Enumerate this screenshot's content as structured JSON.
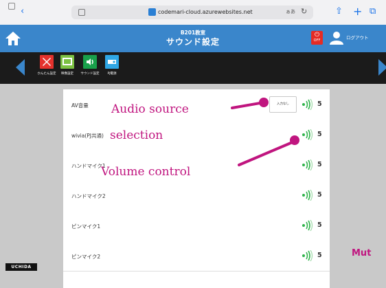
{
  "browser": {
    "url": "codemari-cloud.azurewebsites.net",
    "back_label": "‹",
    "aa_label": "ぁあ",
    "reload_label": "↻",
    "share_label": "⇧",
    "newtab_label": "+",
    "tabs_label": "⧉"
  },
  "header": {
    "room": "B201教室",
    "title": "サウンド設定",
    "off_label": "OFF",
    "logout_label": "ログアウト"
  },
  "toolbar": {
    "items": [
      {
        "label": "かんたん設定",
        "icon": "quick-setup-icon",
        "color": "#e5322d"
      },
      {
        "label": "映像設定",
        "icon": "video-settings-icon",
        "color": "#7cc142"
      },
      {
        "label": "サウンド設定",
        "icon": "sound-settings-icon",
        "color": "#19a04b"
      },
      {
        "label": "PJ電源",
        "icon": "projector-power-icon",
        "color": "#2fa7e6"
      }
    ]
  },
  "sound_rows": [
    {
      "label": "AV音量",
      "volume": "5",
      "source_button": "入力なし"
    },
    {
      "label": "wivia(PJ共通)",
      "volume": "5"
    },
    {
      "label": "ハンドマイク1",
      "volume": "5"
    },
    {
      "label": "ハンドマイク2",
      "volume": "5"
    },
    {
      "label": "ピンマイク1",
      "volume": "5"
    },
    {
      "label": "ピンマイク2",
      "volume": "5"
    }
  ],
  "brand": "UCHIDA",
  "annotations": {
    "audio_source_line1": "Audio  source",
    "audio_source_line2": "selection",
    "volume_control": "Volume control",
    "mute": "Mut"
  },
  "colors": {
    "accent": "#3a86cb",
    "annotation": "#c0157f",
    "speaker": "#2eb34a"
  }
}
